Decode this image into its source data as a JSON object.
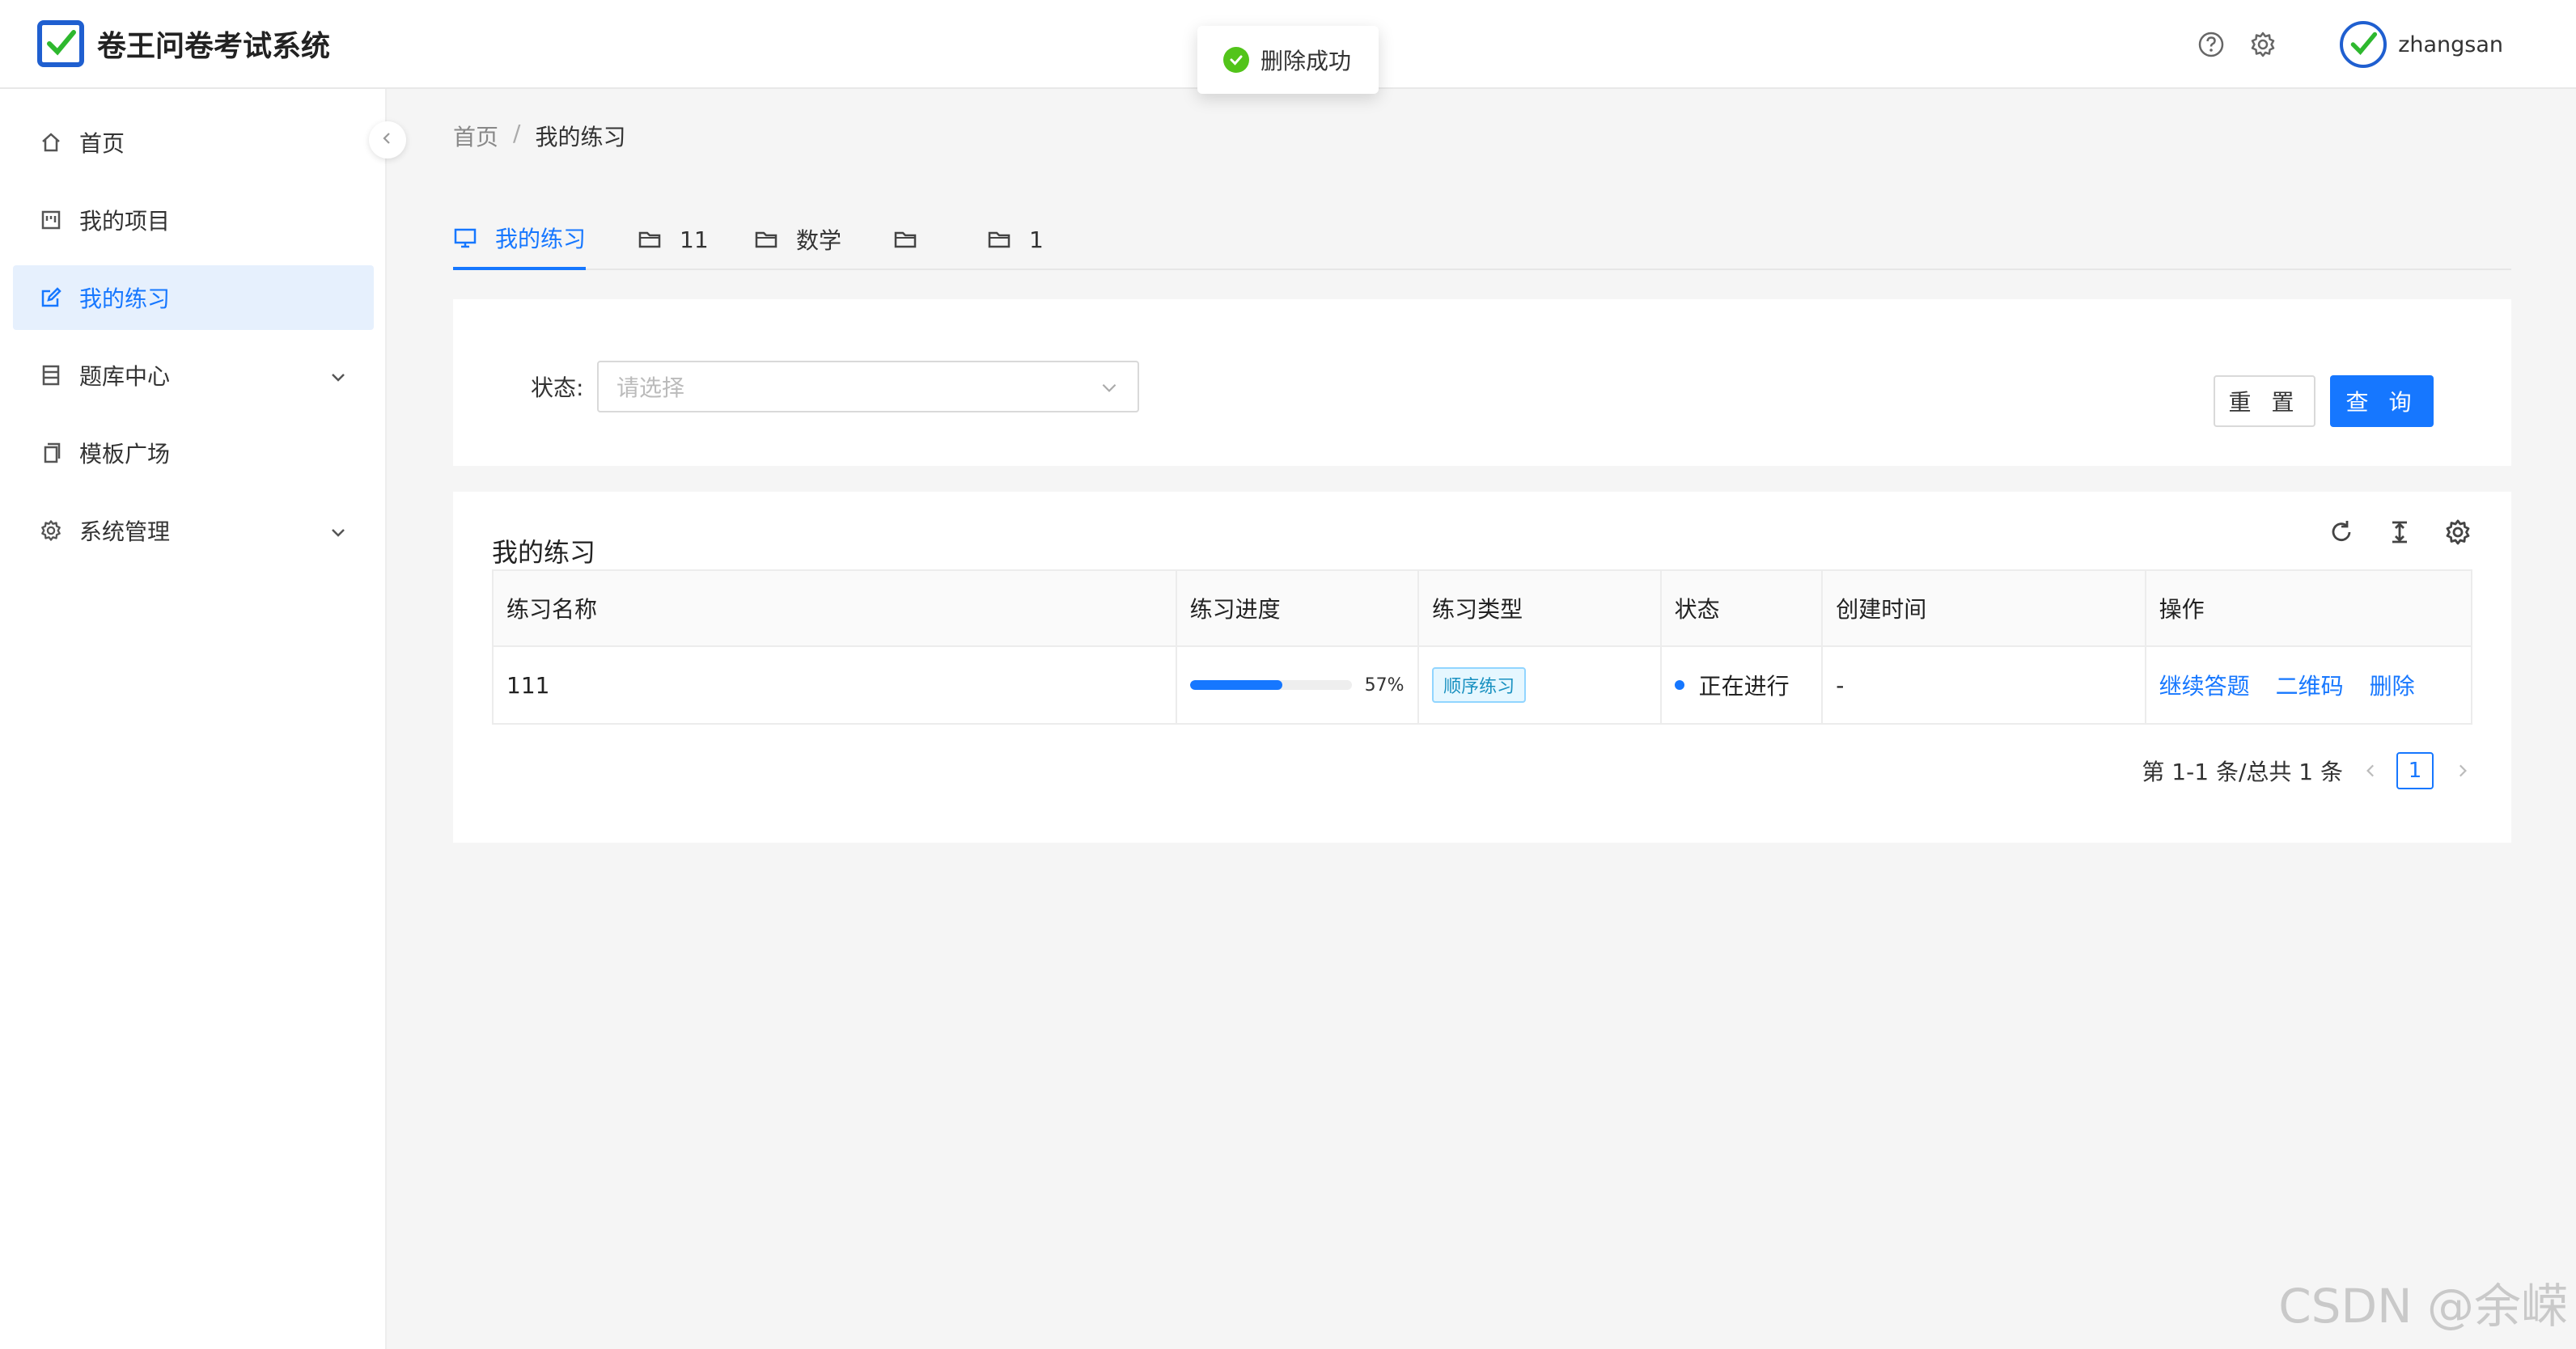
{
  "app": {
    "title": "卷王问卷考试系统"
  },
  "header": {
    "username": "zhangsan"
  },
  "toast": {
    "message": "删除成功"
  },
  "sidebar": {
    "items": [
      {
        "label": "首页"
      },
      {
        "label": "我的项目"
      },
      {
        "label": "我的练习"
      },
      {
        "label": "题库中心"
      },
      {
        "label": "模板广场"
      },
      {
        "label": "系统管理"
      }
    ]
  },
  "breadcrumb": {
    "home": "首页",
    "separator": "/",
    "current": "我的练习"
  },
  "tabs": [
    {
      "label": "我的练习"
    },
    {
      "label": "11"
    },
    {
      "label": "数学"
    },
    {
      "label": ""
    },
    {
      "label": "1"
    }
  ],
  "filter": {
    "status_label": "状态:",
    "placeholder": "请选择",
    "reset_label": "重 置",
    "query_label": "查 询"
  },
  "table": {
    "title": "我的练习",
    "columns": [
      "练习名称",
      "练习进度",
      "练习类型",
      "状态",
      "创建时间",
      "操作"
    ],
    "rows": [
      {
        "name": "111",
        "progress_percent": 57,
        "progress_text": "57%",
        "type": "顺序练习",
        "status": "正在进行",
        "created": "-",
        "actions": [
          "继续答题",
          "二维码",
          "删除"
        ]
      }
    ]
  },
  "pagination": {
    "summary": "第 1-1 条/总共 1 条",
    "current_page": "1"
  },
  "watermark": "CSDN @余嵘",
  "colors": {
    "accent": "#1677ff",
    "brand": "#1f5fd0",
    "success": "#52c41a"
  }
}
